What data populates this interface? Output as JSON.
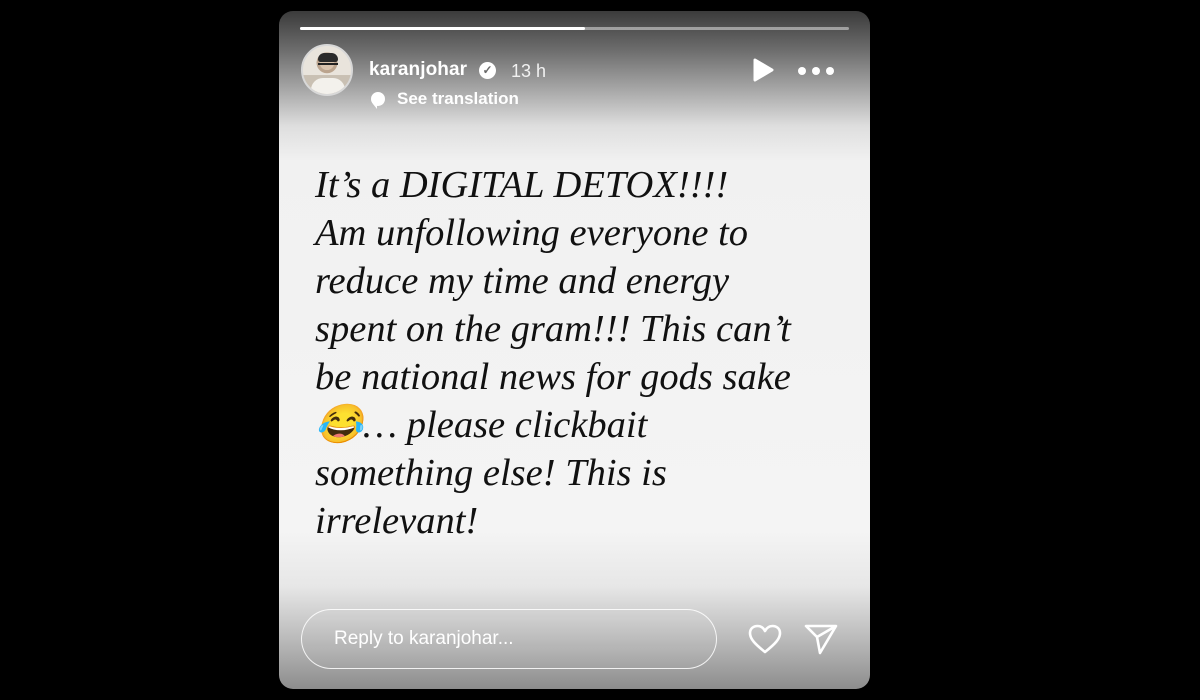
{
  "story": {
    "progress": 0.52,
    "author": {
      "username": "karanjohar",
      "verified": true,
      "time_ago": "13 h"
    },
    "see_translation": "See translation",
    "text": "It’s a DIGITAL DETOX!!!!\nAm unfollowing everyone to\nreduce my time and energy\nspent on the gram!!! This can’t\nbe national news for gods sake\n😂… please clickbait\nsomething else! This is\nirrelevant!",
    "icons": {
      "avatar": "profile-avatar",
      "verified": "verified-badge-icon",
      "translate": "speech-bubble-icon",
      "play": "play-icon",
      "more": "more-options-icon",
      "like": "heart-icon",
      "share": "send-icon"
    }
  },
  "reply": {
    "placeholder": "Reply to karanjohar..."
  }
}
